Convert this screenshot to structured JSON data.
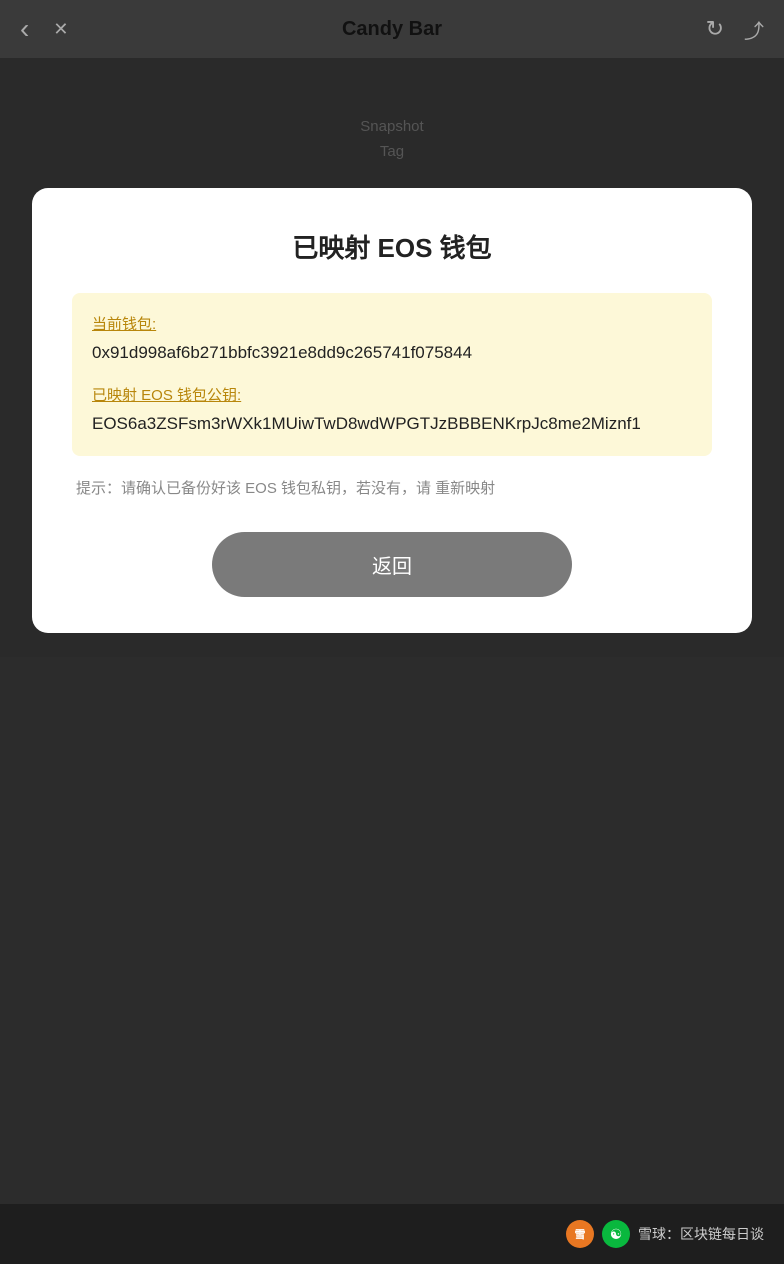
{
  "nav": {
    "title": "Candy Bar",
    "back_label": "‹",
    "close_label": "✕",
    "refresh_label": "↻",
    "share_label": "⤴"
  },
  "background": {
    "hint1": "Snapshot",
    "hint2": "Tag"
  },
  "card": {
    "title": "已映射 EOS 钱包",
    "info_box": {
      "wallet_label": "当前钱包:",
      "wallet_value": "0x91d998af6b271bbfc3921e8dd9c265741f075844",
      "eos_label": "已映射 EOS 钱包公钥:",
      "eos_value": "EOS6a3ZSFsm3rWXk1MUiwTwD8wdWPGTJzBBBENKrpJc8me2Miznf1"
    },
    "hint_text": "提示：请确认已备份好该 EOS 钱包私钥，若没有，请 重新映射",
    "back_button_label": "返回"
  },
  "watermark": {
    "logo_text": "雪",
    "name": "雪球：区块链每日谈"
  }
}
